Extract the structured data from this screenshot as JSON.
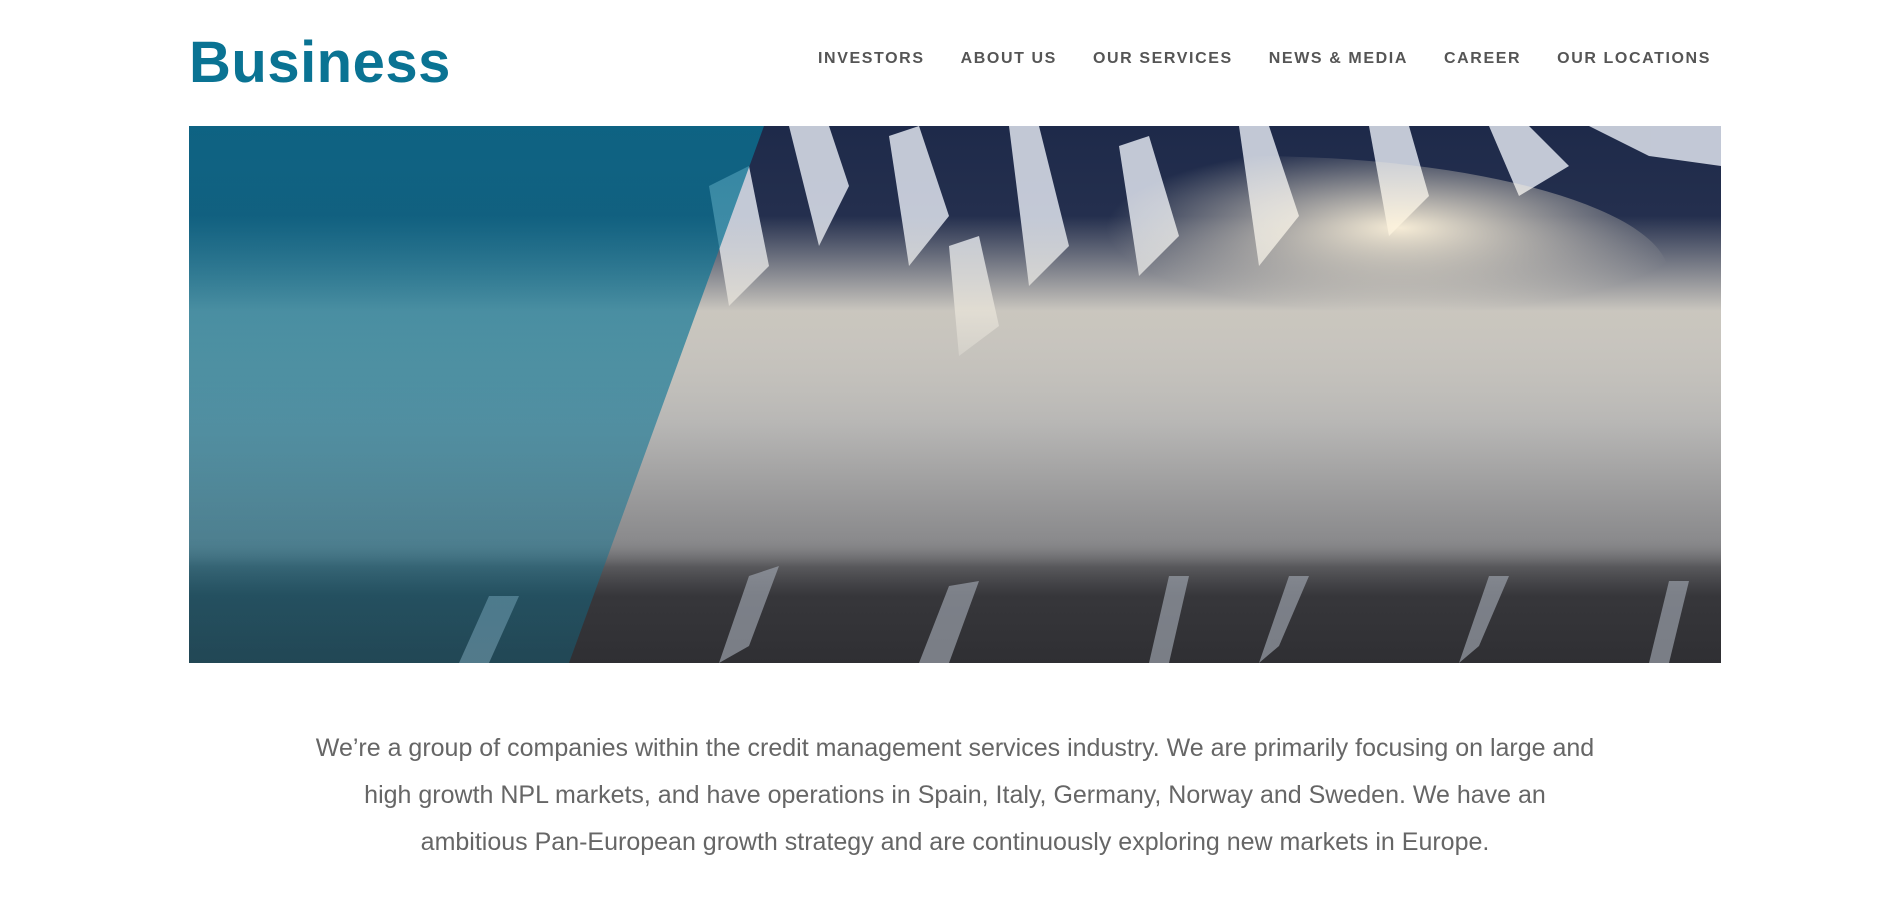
{
  "header": {
    "logo_text": "Business"
  },
  "nav": {
    "items": [
      {
        "label": "INVESTORS"
      },
      {
        "label": "ABOUT US"
      },
      {
        "label": "OUR SERVICES"
      },
      {
        "label": "NEWS & MEDIA"
      },
      {
        "label": "CAREER"
      },
      {
        "label": "OUR LOCATIONS"
      }
    ]
  },
  "hero": {
    "image": "snowy-mountain-with-clouds",
    "overlay_color": "#0a7393"
  },
  "intro": {
    "text": "We’re a group of companies within the credit management services industry. We are primarily focusing on large and high growth NPL markets, and have operations in Spain, Italy, Germany, Norway and Sweden. We have an ambitious Pan-European growth strategy and are continuously exploring new markets in Europe."
  },
  "colors": {
    "brand": "#0a7393",
    "nav_text": "#555555",
    "body_text": "#666666"
  }
}
